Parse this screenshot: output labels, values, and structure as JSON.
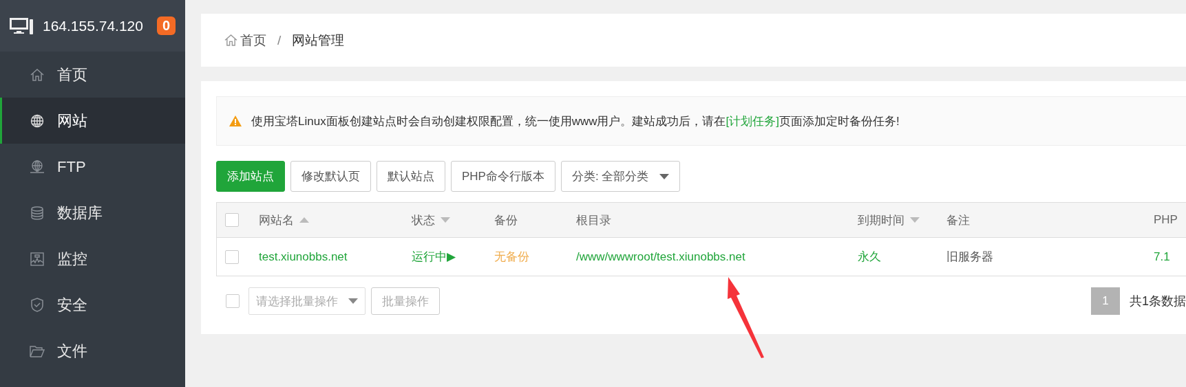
{
  "server": {
    "ip": "164.155.74.120",
    "badge": "0"
  },
  "sidebar": {
    "items": [
      {
        "label": "首页",
        "kind": "home",
        "selected": false
      },
      {
        "label": "网站",
        "kind": "globe",
        "selected": true
      },
      {
        "label": "FTP",
        "kind": "ftp",
        "selected": false
      },
      {
        "label": "数据库",
        "kind": "database",
        "selected": false
      },
      {
        "label": "监控",
        "kind": "monitor",
        "selected": false
      },
      {
        "label": "安全",
        "kind": "shield",
        "selected": false
      },
      {
        "label": "文件",
        "kind": "folder",
        "selected": false
      }
    ]
  },
  "breadcrumb": {
    "items": [
      "首页",
      "网站管理"
    ],
    "separator": "/"
  },
  "alert": {
    "text_before": "使用宝塔Linux面板创建站点时会自动创建权限配置，统一使用www用户。建站成功后，请在",
    "link": "[计划任务]",
    "text_after": "页面添加定时备份任务!"
  },
  "toolbar": {
    "buttons": [
      {
        "label": "添加站点",
        "primary": true
      },
      {
        "label": "修改默认页",
        "primary": false
      },
      {
        "label": "默认站点",
        "primary": false
      },
      {
        "label": "PHP命令行版本",
        "primary": false
      }
    ],
    "category": "分类: 全部分类"
  },
  "table": {
    "header_checked": false,
    "columns": [
      {
        "label": "网站名",
        "sortable": true,
        "ascending": true
      },
      {
        "label": "状态",
        "sortable": true,
        "ascending": false
      },
      {
        "label": "备份",
        "sortable": false
      },
      {
        "label": "根目录",
        "sortable": false
      },
      {
        "label": "到期时间",
        "sortable": true,
        "ascending": false
      },
      {
        "label": "备注",
        "sortable": false
      },
      {
        "label": "PHP",
        "sortable": false
      }
    ],
    "rows": [
      {
        "checked": false,
        "cells": [
          {
            "text": "test.xiunobbs.net",
            "kind": "ok"
          },
          {
            "text": "运行中▶",
            "kind": "ok"
          },
          {
            "text": "无备份",
            "kind": "warn"
          },
          {
            "text": "/www/wwwroot/test.xiunobbs.net",
            "kind": "ok"
          },
          {
            "text": "永久",
            "kind": "ok"
          },
          {
            "text": "旧服务器",
            "kind": "plain"
          },
          {
            "text": "7.1",
            "kind": "ok"
          }
        ]
      }
    ]
  },
  "footer": {
    "checked": false,
    "batch_placeholder": "请选择批量操作",
    "batch_button": {
      "label": "批量操作",
      "disabled": true
    },
    "pages": [
      {
        "label": "1",
        "selected": true
      }
    ],
    "summary": "共1条数据"
  }
}
